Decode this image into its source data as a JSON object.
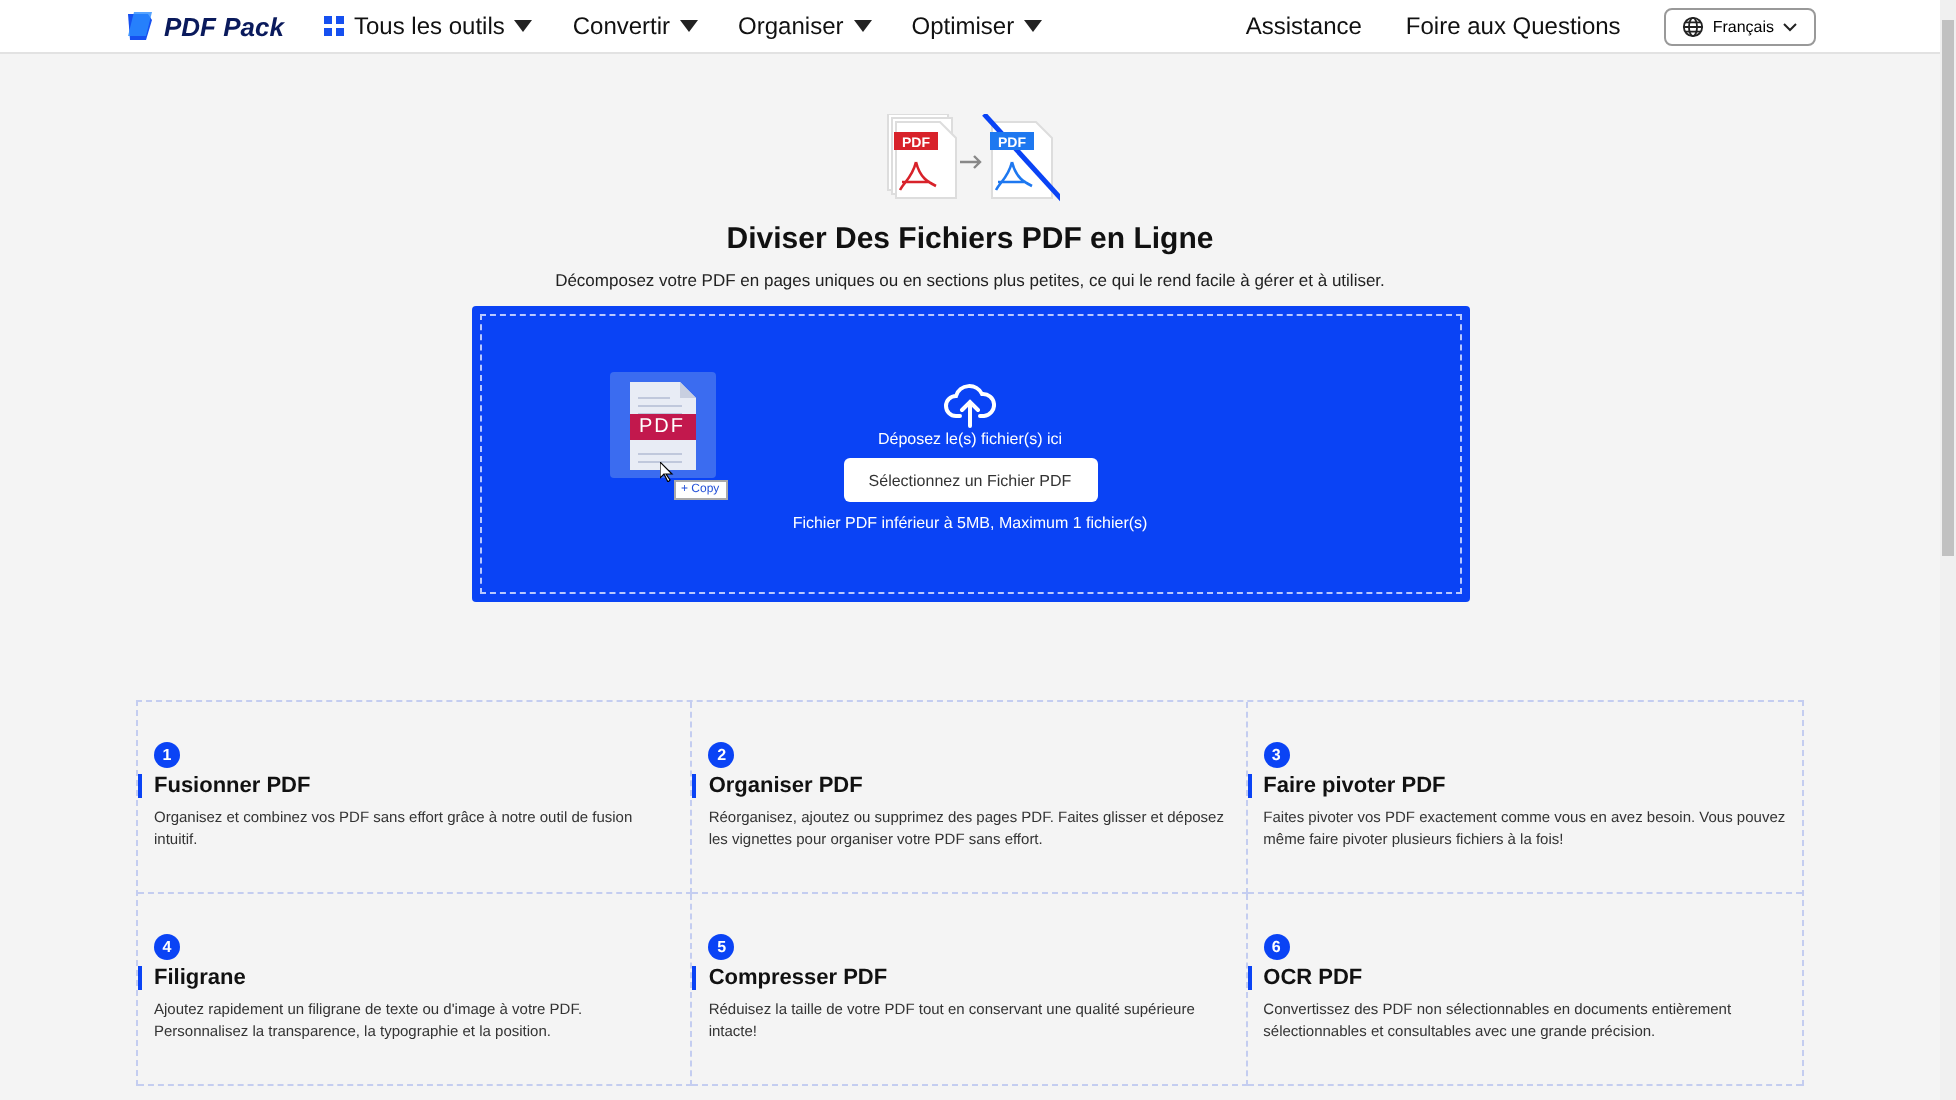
{
  "header": {
    "logo": "PDF Pack",
    "nav": [
      {
        "label": "Tous les outils",
        "kind": "grid"
      },
      {
        "label": "Convertir",
        "kind": "plain"
      },
      {
        "label": "Organiser",
        "kind": "plain"
      },
      {
        "label": "Optimiser",
        "kind": "plain"
      }
    ],
    "links": [
      "Assistance",
      "Foire aux Questions"
    ],
    "language": "Français"
  },
  "hero": {
    "source_label": "PDF",
    "target_label": "PDF",
    "title": "Diviser Des Fichiers PDF en Ligne",
    "subtitle": "Décomposez votre PDF en pages uniques ou en sections plus petites, ce qui le rend facile à gérer et à utiliser."
  },
  "upload": {
    "file_label": "PDF",
    "copy_label": "+ Copy",
    "drop_text": "Déposez le(s) fichier(s) ici",
    "button": "Sélectionnez un Fichier PDF",
    "limit": "Fichier PDF inférieur à 5MB, Maximum 1 fichier(s)"
  },
  "features": [
    {
      "number": "1",
      "title": "Fusionner PDF",
      "text": "Organisez et combinez vos PDF sans effort grâce à notre outil de fusion intuitif."
    },
    {
      "number": "2",
      "title": "Organiser PDF",
      "text": "Réorganisez, ajoutez ou supprimez des pages PDF. Faites glisser et déposez les vignettes pour organiser votre PDF sans effort."
    },
    {
      "number": "3",
      "title": "Faire pivoter PDF",
      "text": "Faites pivoter vos PDF exactement comme vous en avez besoin. Vous pouvez même faire pivoter plusieurs fichiers à la fois!"
    },
    {
      "number": "4",
      "title": "Filigrane",
      "text": "Ajoutez rapidement un filigrane de texte ou d'image à votre PDF. Personnalisez la transparence, la typographie et la position."
    },
    {
      "number": "5",
      "title": "Compresser PDF",
      "text": "Réduisez la taille de votre PDF tout en conservant une qualité supérieure intacte!"
    },
    {
      "number": "6",
      "title": "OCR PDF",
      "text": "Convertissez des PDF non sélectionnables en documents entièrement sélectionnables et consultables avec une grande précision."
    }
  ]
}
